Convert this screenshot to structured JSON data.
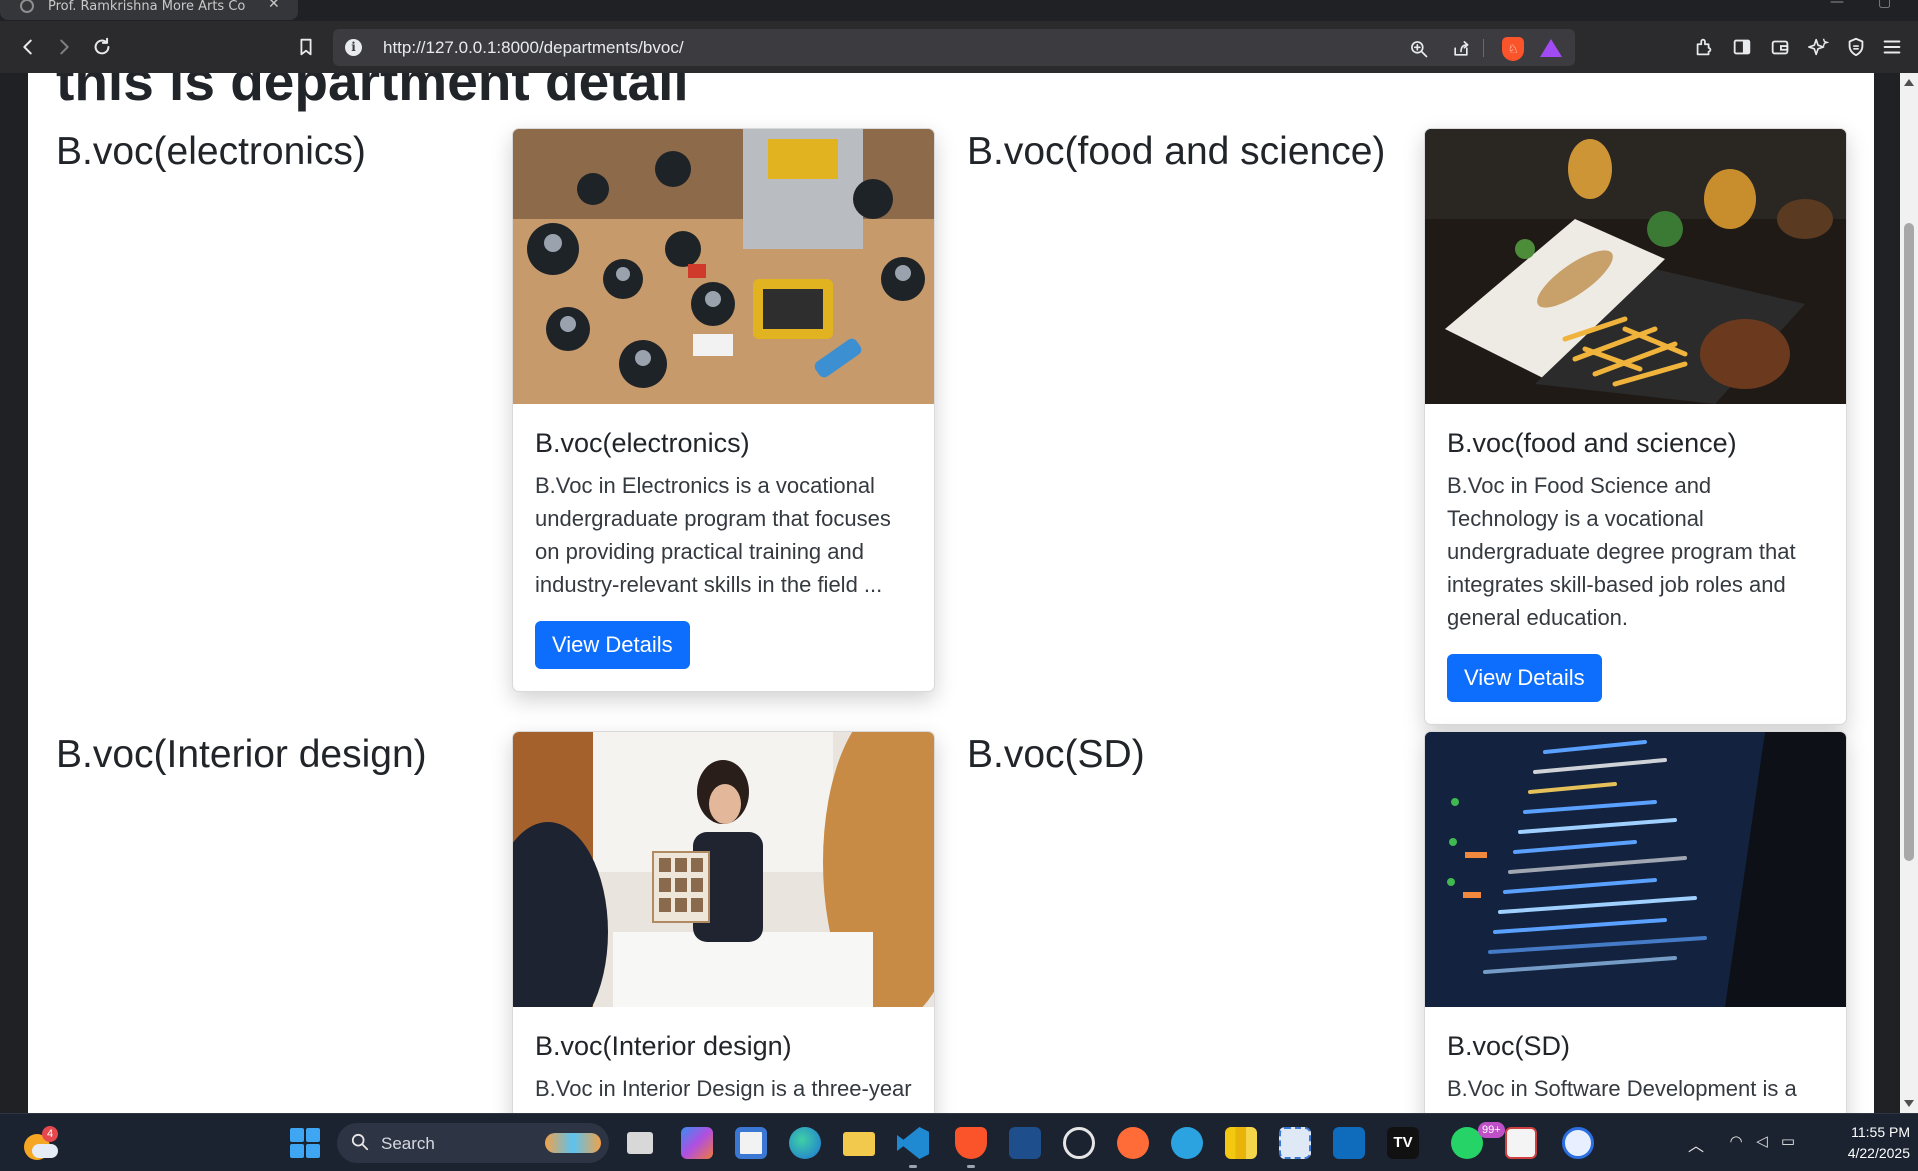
{
  "browser": {
    "tab_title": "Prof. Ramkrishna More Arts Co",
    "url": "http://127.0.0.1:8000/departments/bvoc/"
  },
  "page": {
    "heading": "this is department detail",
    "departments": [
      {
        "name": "B.voc(electronics)",
        "card_title": "B.voc(electronics)",
        "description": "B.Voc in Electronics is a vocational undergraduate program that focuses on providing practical training and industry-relevant skills in the field ...",
        "button": "View Details",
        "image": "electronics-circuit-board-photo"
      },
      {
        "name": "B.voc(food and science)",
        "card_title": "B.voc(food and science)",
        "description": "B.Voc in Food Science and Technology is a vocational undergraduate degree program that integrates skill-based job roles and general education.",
        "button": "View Details",
        "image": "food-platter-photo"
      },
      {
        "name": "B.voc(Interior design)",
        "card_title": "B.voc(Interior design)",
        "description": "B.Voc in Interior Design is a three-year",
        "image": "interior-designer-presentation-photo"
      },
      {
        "name": "B.voc(SD)",
        "card_title": "B.voc(SD)",
        "description": "B.Voc in Software Development is a",
        "image": "code-on-laptop-photo"
      }
    ]
  },
  "taskbar": {
    "search_label": "Search",
    "weather_badge": "4",
    "whatsapp_badge": "99+",
    "time": "11:55 PM",
    "date": "4/22/2025"
  },
  "colors": {
    "primary_button": "#0d6efd",
    "browser_frame": "#202124",
    "taskbar": "#1c2330"
  }
}
